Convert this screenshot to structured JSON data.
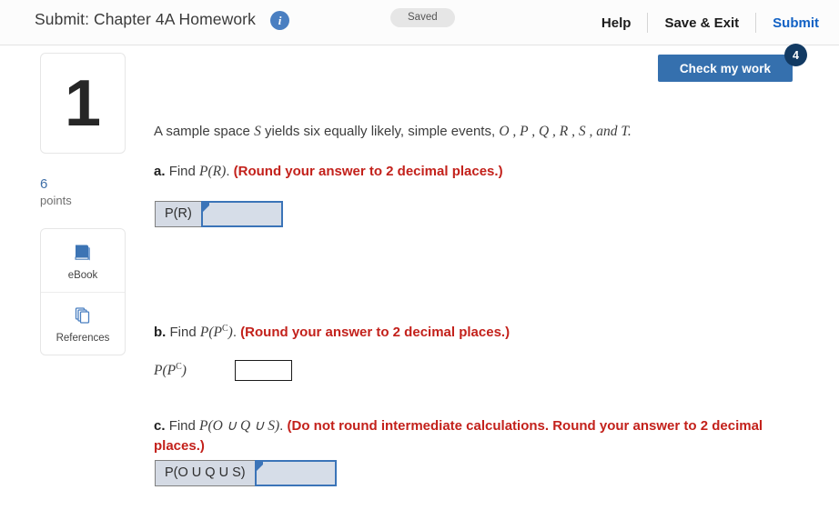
{
  "header": {
    "title": "Submit: Chapter 4A Homework",
    "info_icon": "info-icon",
    "saved_label": "Saved",
    "help_label": "Help",
    "save_exit_label": "Save & Exit",
    "submit_label": "Submit",
    "accent_blue": "#1161c4"
  },
  "check_work": {
    "label": "Check my work",
    "badge_count": "4",
    "button_color": "#3570ae",
    "badge_color": "#123a63"
  },
  "rail": {
    "question_number": "1",
    "points_value": "6",
    "points_label": "points",
    "tools": [
      {
        "label": "eBook",
        "icon": "book-icon"
      },
      {
        "label": "References",
        "icon": "pages-stack-icon"
      }
    ]
  },
  "question": {
    "stem_pre": "A sample space ",
    "stem_var_s": "S",
    "stem_mid": " yields six equally likely, simple events, ",
    "stem_events": "O , P , Q , R , S , and T.",
    "parts": [
      {
        "letter": "a.",
        "find": "Find ",
        "expr": "P(R)",
        "period": ".",
        "instruction": "(Round your answer to 2 decimal places.)"
      },
      {
        "letter": "b.",
        "find": "Find ",
        "expr_base": "P(P",
        "expr_sup": "C",
        "expr_tail": ")",
        "period": ".",
        "instruction": "(Round your answer to 2 decimal places.)"
      },
      {
        "letter": "c.",
        "find": "Find ",
        "expr": "P(O ∪ Q ∪ S)",
        "period": ".",
        "instruction": "(Do not round intermediate calculations. Round your answer to 2 decimal places.)"
      }
    ],
    "answers": {
      "a": {
        "label": "P(R)",
        "value": "",
        "placeholder": ""
      },
      "b": {
        "label_base": "P(P",
        "label_sup": "C",
        "label_tail": ")",
        "value": "",
        "placeholder": ""
      },
      "c": {
        "label": "P(O U Q U S)",
        "value": "",
        "placeholder": ""
      }
    },
    "instruction_color": "#c3211b"
  }
}
